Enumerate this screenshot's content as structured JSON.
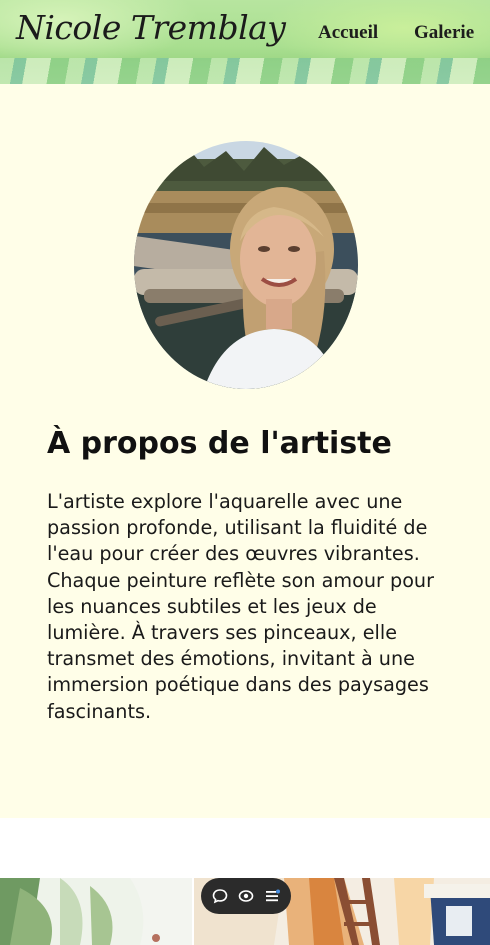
{
  "header": {
    "logo_text": "Nicole Tremblay",
    "nav": [
      {
        "label": "Accueil"
      },
      {
        "label": "Galerie"
      }
    ]
  },
  "about": {
    "title": "À propos de l'artiste",
    "text": "L'artiste explore l'aquarelle avec une passion profonde, utilisant la fluidité de l'eau pour créer des œuvres vibrantes. Chaque peinture reflète son amour pour les nuances subtiles et les jeux de lumière. À travers ses pinceaux, elle transmet des émotions, invitant à une immersion poétique dans des paysages fascinants."
  },
  "toolbar": {
    "icons": [
      "chat-icon",
      "eye-icon",
      "menu-icon"
    ]
  },
  "colors": {
    "header_green": "#a9df90",
    "about_background": "#fffee8",
    "toolbar": "#2b2b2b"
  }
}
